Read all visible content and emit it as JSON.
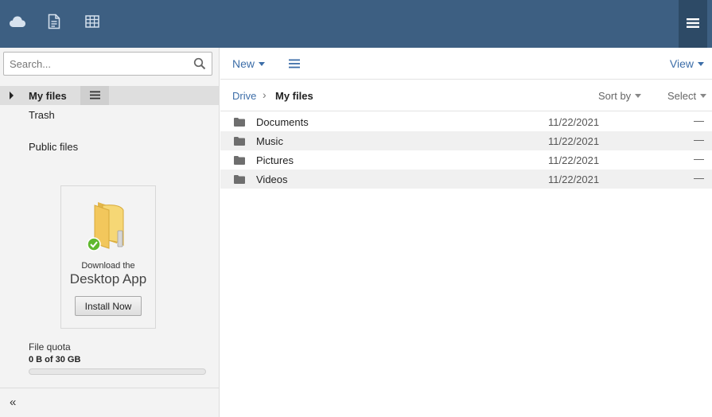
{
  "topbar": {
    "icons": [
      "cloud-icon",
      "document-icon",
      "spreadsheet-icon",
      "hamburger-menu-icon"
    ]
  },
  "sidebar": {
    "search_placeholder": "Search...",
    "nav": [
      {
        "label": "My files",
        "active": true
      },
      {
        "label": "Trash",
        "active": false
      },
      {
        "label": "Public files",
        "active": false
      }
    ],
    "promo": {
      "line1": "Download the",
      "line2": "Desktop App",
      "button": "Install Now"
    },
    "quota": {
      "label": "File quota",
      "value": "0 B of 30 GB",
      "used_fraction": 0
    },
    "collapse_label": "«"
  },
  "toolbar": {
    "new_label": "New",
    "view_label": "View"
  },
  "breadcrumb": {
    "root": "Drive",
    "separator": "›",
    "current": "My files"
  },
  "list_controls": {
    "sort_label": "Sort by",
    "select_label": "Select"
  },
  "files": [
    {
      "name": "Documents",
      "date": "11/22/2021",
      "size": "—"
    },
    {
      "name": "Music",
      "date": "11/22/2021",
      "size": "—"
    },
    {
      "name": "Pictures",
      "date": "11/22/2021",
      "size": "—"
    },
    {
      "name": "Videos",
      "date": "11/22/2021",
      "size": "—"
    }
  ],
  "colors": {
    "topbar": "#3d5f82",
    "accent": "#3d6ea8",
    "success": "#5fb82e"
  }
}
